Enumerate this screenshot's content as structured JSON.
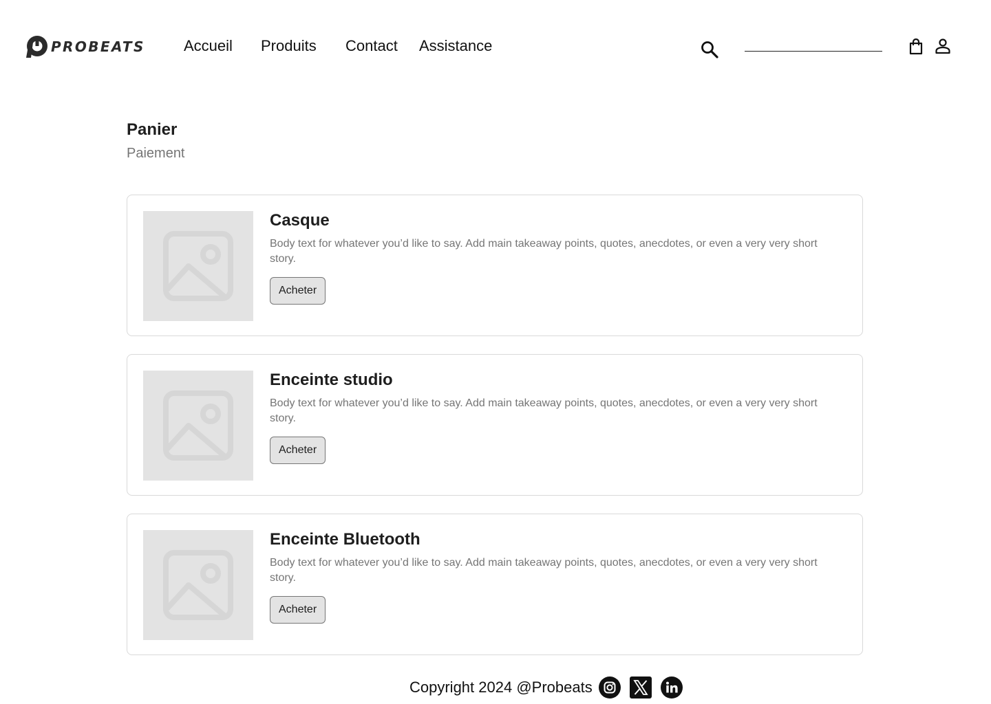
{
  "header": {
    "brand": "PROBEATS",
    "nav": [
      {
        "label": "Accueil"
      },
      {
        "label": "Produits"
      },
      {
        "label": "Contact"
      },
      {
        "label": "Assistance"
      }
    ],
    "search": {
      "value": "",
      "placeholder": ""
    }
  },
  "page": {
    "title": "Panier",
    "subtitle": "Paiement"
  },
  "products": [
    {
      "title": "Casque",
      "description": "Body text for whatever you’d like to say. Add main takeaway points, quotes, anecdotes, or even a very very short story.",
      "button": "Acheter"
    },
    {
      "title": "Enceinte studio",
      "description": "Body text for whatever you’d like to say. Add main takeaway points, quotes, anecdotes, or even a very very short story.",
      "button": "Acheter"
    },
    {
      "title": "Enceinte Bluetooth",
      "description": "Body text for whatever you’d like to say. Add main takeaway points, quotes, anecdotes, or even a very very short story.",
      "button": "Acheter"
    }
  ],
  "footer": {
    "copyright": "Copyright 2024 @Probeats",
    "social": [
      "instagram-icon",
      "x-icon",
      "linkedin-icon"
    ]
  },
  "colors": {
    "text": "#1e1e1e",
    "muted": "#757575",
    "border": "#d9d9d9",
    "placeholder": "#e3e3e3"
  }
}
